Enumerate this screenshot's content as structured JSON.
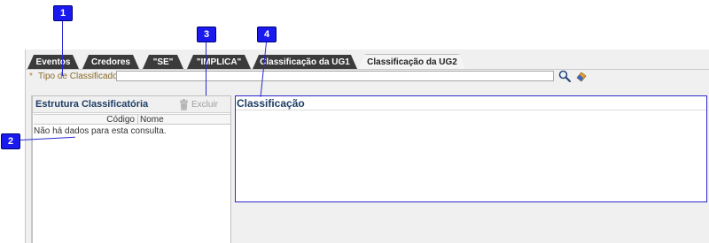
{
  "callouts": [
    "1",
    "2",
    "3",
    "4"
  ],
  "tabs": [
    {
      "label": "Eventos",
      "active": false
    },
    {
      "label": "Credores",
      "active": false
    },
    {
      "label": "\"SE\"",
      "active": false
    },
    {
      "label": "\"IMPLICA\"",
      "active": false
    },
    {
      "label": "Classificação da UG1",
      "active": false
    },
    {
      "label": "Classificação da UG2",
      "active": true
    }
  ],
  "filter": {
    "required_mark": "*",
    "label": "Tipo de Classificador",
    "value": "",
    "search_icon": "search-icon",
    "clear_icon": "eraser-icon"
  },
  "left_panel": {
    "title": "Estrutura Classificatória",
    "delete_label": "Excluir",
    "columns": [
      "Código",
      "Nome"
    ],
    "empty_message": "Não há dados para esta consulta."
  },
  "right_panel": {
    "title": "Classificação"
  },
  "colors": {
    "tab_dark": "#3b3b3b",
    "title_blue": "#1e3e66",
    "callout_blue": "#1a1aee",
    "label_brown": "#8a6a2a"
  }
}
